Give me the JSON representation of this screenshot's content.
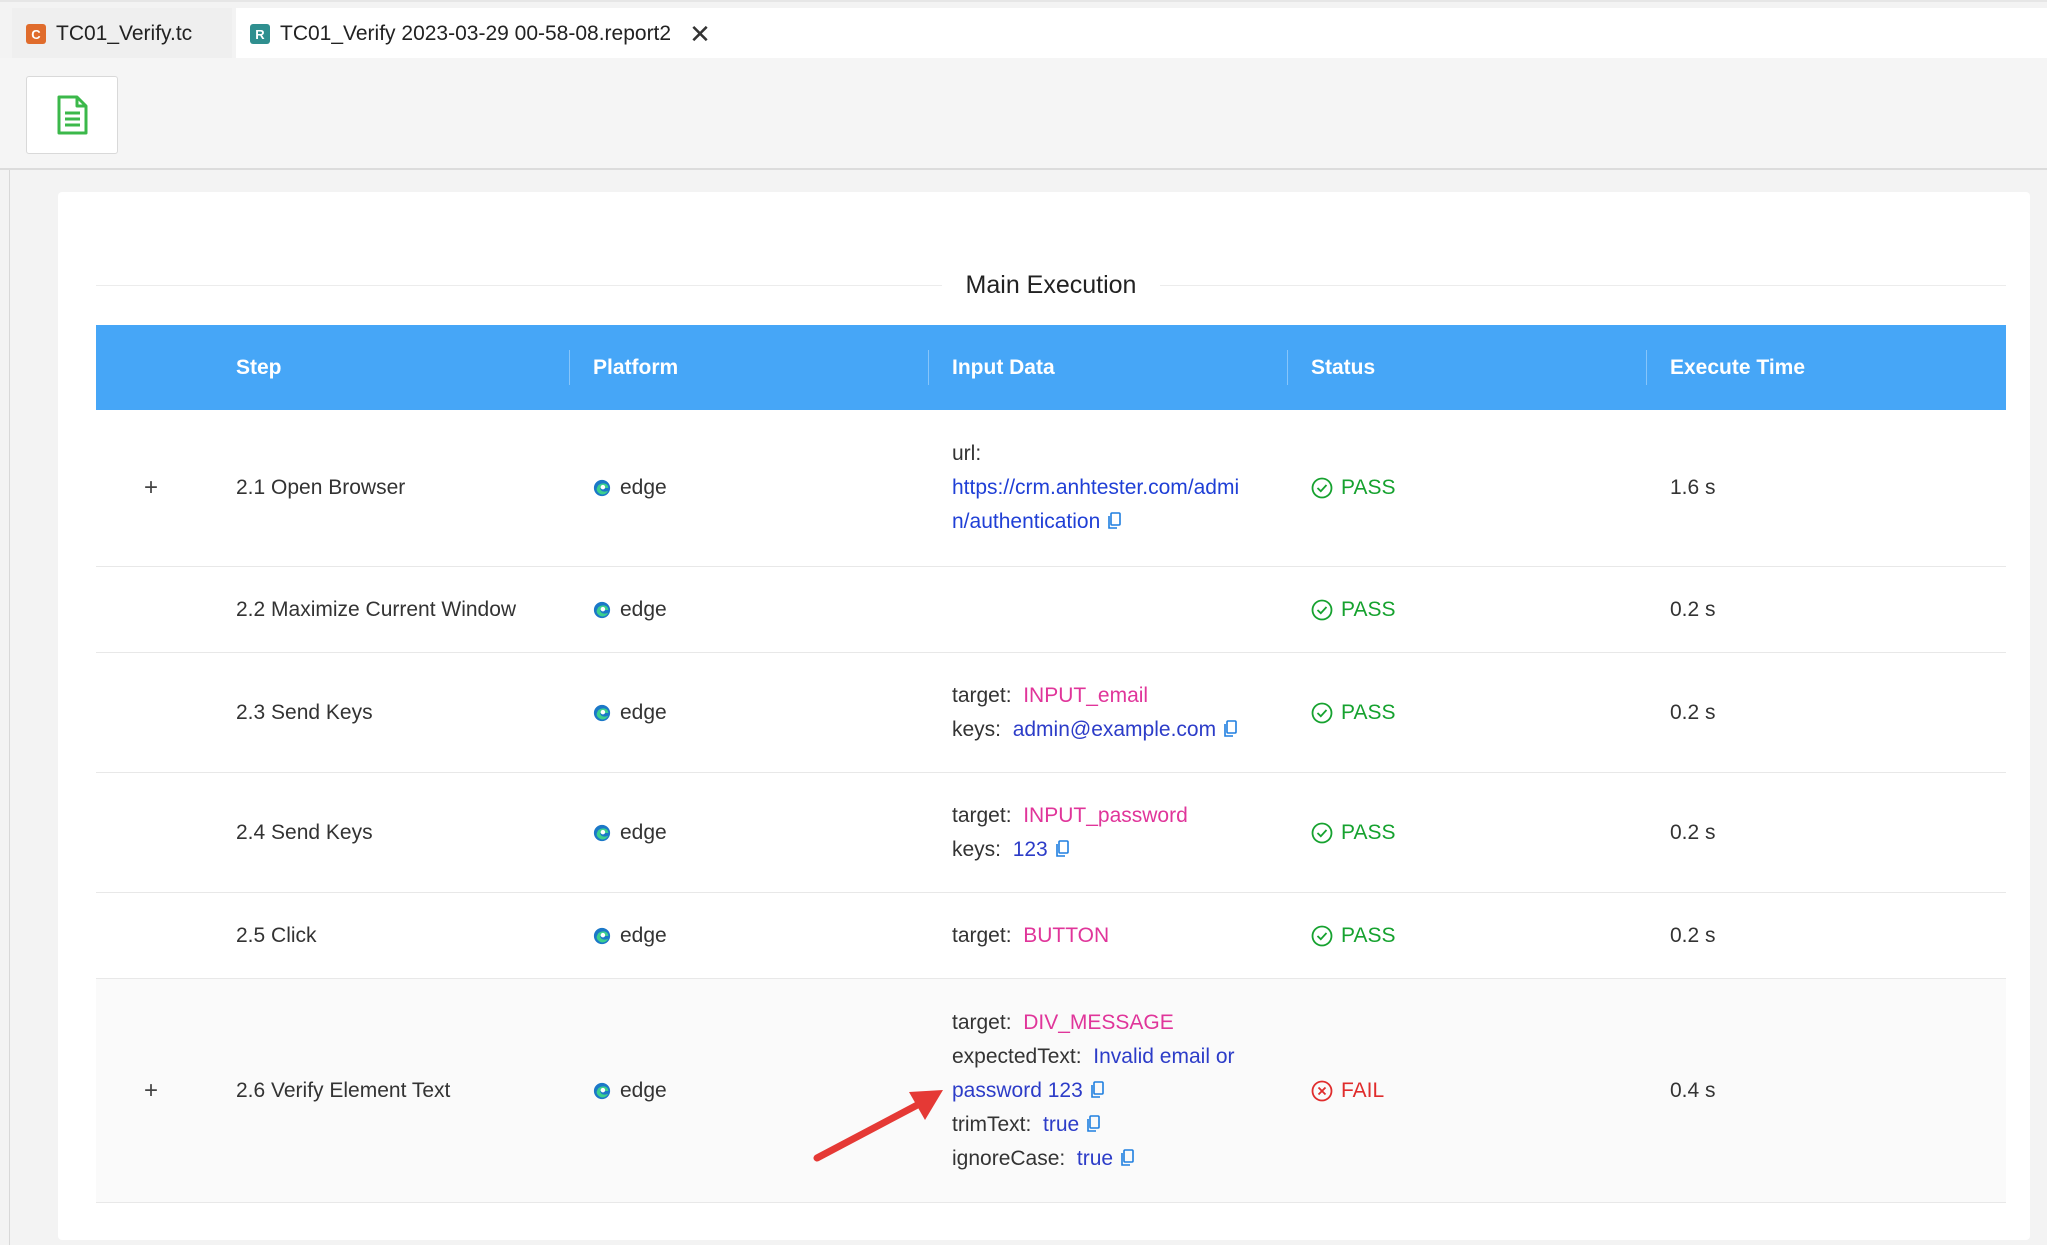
{
  "tabs": [
    {
      "badge": "C",
      "label": "TC01_Verify.tc"
    },
    {
      "badge": "R",
      "label": "TC01_Verify 2023-03-29 00-58-08.report2",
      "close": "✕"
    }
  ],
  "toolbar": {
    "report_icon": "document-icon"
  },
  "section": {
    "title": "Main Execution"
  },
  "table": {
    "headers": [
      "Step",
      "Platform",
      "Input Data",
      "Status",
      "Execute Time"
    ],
    "rows": [
      {
        "step": "2.1 Open Browser",
        "platform": "edge",
        "status": "PASS",
        "time": "1.6 s",
        "url_key": "url:",
        "url_line1": "https://crm.anhtester.com/admi",
        "url_line2": "n/authentication"
      },
      {
        "step": "2.2 Maximize Current Window",
        "platform": "edge",
        "status": "PASS",
        "time": "0.2 s"
      },
      {
        "step": "2.3 Send Keys",
        "platform": "edge",
        "status": "PASS",
        "time": "0.2 s",
        "target_key": "target:",
        "target": "INPUT_email",
        "keys_key": "keys:",
        "keys": "admin@example.com"
      },
      {
        "step": "2.4 Send Keys",
        "platform": "edge",
        "status": "PASS",
        "time": "0.2 s",
        "target_key": "target:",
        "target": "INPUT_password",
        "keys_key": "keys:",
        "keys": "123"
      },
      {
        "step": "2.5 Click",
        "platform": "edge",
        "status": "PASS",
        "time": "0.2 s",
        "target_key": "target:",
        "target": "BUTTON"
      },
      {
        "step": "2.6 Verify Element Text",
        "platform": "edge",
        "status": "FAIL",
        "time": "0.4 s",
        "target_key": "target:",
        "target": "DIV_MESSAGE",
        "expected_key": "expectedText:",
        "expected_line1": "Invalid email or",
        "expected_line2": "password 123",
        "trim_key": "trimText:",
        "trim": "true",
        "ignore_key": "ignoreCase:",
        "ignore": "true"
      }
    ]
  },
  "colors": {
    "header": "#46a6f7",
    "pass": "#16a22f",
    "fail": "#e02c2c",
    "pink": "#e0359a",
    "arrow": "#e53935"
  }
}
